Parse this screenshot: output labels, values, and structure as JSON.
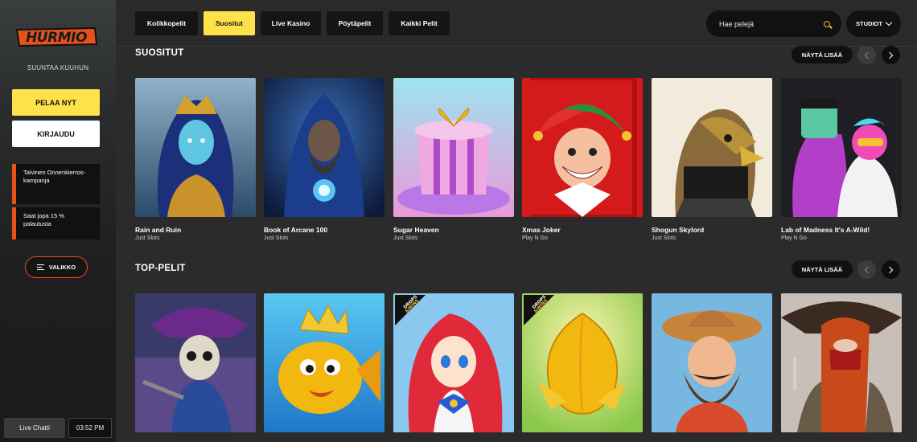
{
  "sidebar": {
    "logo_text": "HURMIO",
    "tagline": "SUUNTAA KUUHUN",
    "play_label": "PELAA NYT",
    "login_label": "KIRJAUDU",
    "promos": [
      {
        "text": "Talvinen Onnenkierros-kampanja"
      },
      {
        "text": "Saat jopa 15 % palautusta"
      }
    ],
    "menu_label": "VALIKKO",
    "live_chat_label": "Live Chatti",
    "clock": "03:52 PM"
  },
  "topbar": {
    "tabs": [
      {
        "label": "Kolikkopelit"
      },
      {
        "label": "Suositut",
        "active": true
      },
      {
        "label": "Live Kasino"
      },
      {
        "label": "Pöytäpelit"
      },
      {
        "label": "Kaikki Pelit"
      }
    ],
    "search_placeholder": "Hae pelejä",
    "studios_label": "STUDIOT"
  },
  "sections": [
    {
      "title": "SUOSITUT",
      "show_more": "NÄYTÄ LISÄÄ",
      "games": [
        {
          "name": "Rain and Ruin",
          "provider": "Just Slots"
        },
        {
          "name": "Book of Arcane 100",
          "provider": "Just Slots"
        },
        {
          "name": "Sugar Heaven",
          "provider": "Just Slots"
        },
        {
          "name": "Xmas Joker",
          "provider": "Play N Go"
        },
        {
          "name": "Shogun Skylord",
          "provider": "Just Slots"
        },
        {
          "name": "Lab of Madness It's A-Wild!",
          "provider": "Play N Go"
        }
      ]
    },
    {
      "title": "TOP-PELIT",
      "show_more": "NÄYTÄ LISÄÄ",
      "games": [
        {
          "badge": ""
        },
        {
          "badge": ""
        },
        {
          "badge": "DROPS & WINS"
        },
        {
          "badge": "DROPS & WINS"
        },
        {
          "badge": ""
        },
        {
          "badge": ""
        }
      ]
    }
  ],
  "colors": {
    "accent_yellow": "#ffe14a",
    "accent_orange": "#e8521a",
    "background": "#2b2b2b"
  }
}
